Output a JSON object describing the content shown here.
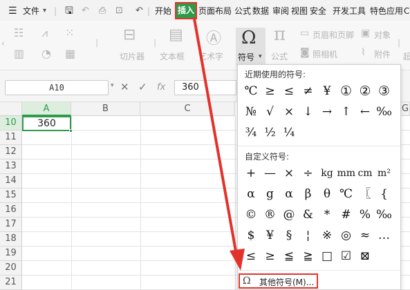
{
  "menubar": {
    "menu_icon": "hamburger-icon",
    "file_label": "文件",
    "tabs": [
      "开始",
      "插入",
      "页面布局",
      "公式",
      "数据",
      "审阅",
      "视图",
      "安全",
      "开发工具",
      "特色应用"
    ],
    "active_tab": "插入",
    "overflow_label": "C"
  },
  "ribbon": {
    "labels": {
      "screenshot": "切片器",
      "textbox": "文本框",
      "wordart": "艺术字",
      "symbol": "符号",
      "formula": "公式",
      "header_footer": "页眉和页脚",
      "camera": "照相机",
      "object": "对象",
      "attachment": "附件",
      "ex": "超"
    }
  },
  "formula_bar": {
    "name_box": "A10",
    "value": "360",
    "fx": "fx"
  },
  "grid": {
    "columns": [
      "A",
      "B",
      "C",
      "G"
    ],
    "rows": [
      "10",
      "11",
      "12",
      "13",
      "14",
      "15",
      "16",
      "17",
      "18",
      "19",
      "20",
      "21"
    ],
    "active_cell_value": "360"
  },
  "symbols_dropdown": {
    "recent_title": "近期使用的符号:",
    "recent": [
      "℃",
      "≥",
      "≤",
      "≠",
      "¥",
      "①",
      "②",
      "③",
      "№",
      "√",
      "×",
      "↓",
      "→",
      "↑",
      "←",
      "‰",
      "¾",
      "½",
      "¼"
    ],
    "custom_title": "自定义符号:",
    "custom": [
      "+",
      "—",
      "×",
      "÷",
      "kg",
      "mm",
      "cm",
      "m²",
      "α",
      "g",
      "α",
      "β",
      "θ",
      "℃",
      "〖",
      "{",
      "©",
      "®",
      "@",
      "&",
      "*",
      "#",
      "%",
      "‰",
      "$",
      "¥",
      "§",
      "¦",
      "※",
      "◎",
      "≈",
      "…",
      "≤",
      "≥",
      "≦",
      "≧",
      "□",
      "☑",
      "⊠"
    ],
    "more_label": "其他符号(M)..."
  },
  "colors": {
    "accent_green": "#2e9b4a",
    "highlight_red": "#e3322b"
  }
}
